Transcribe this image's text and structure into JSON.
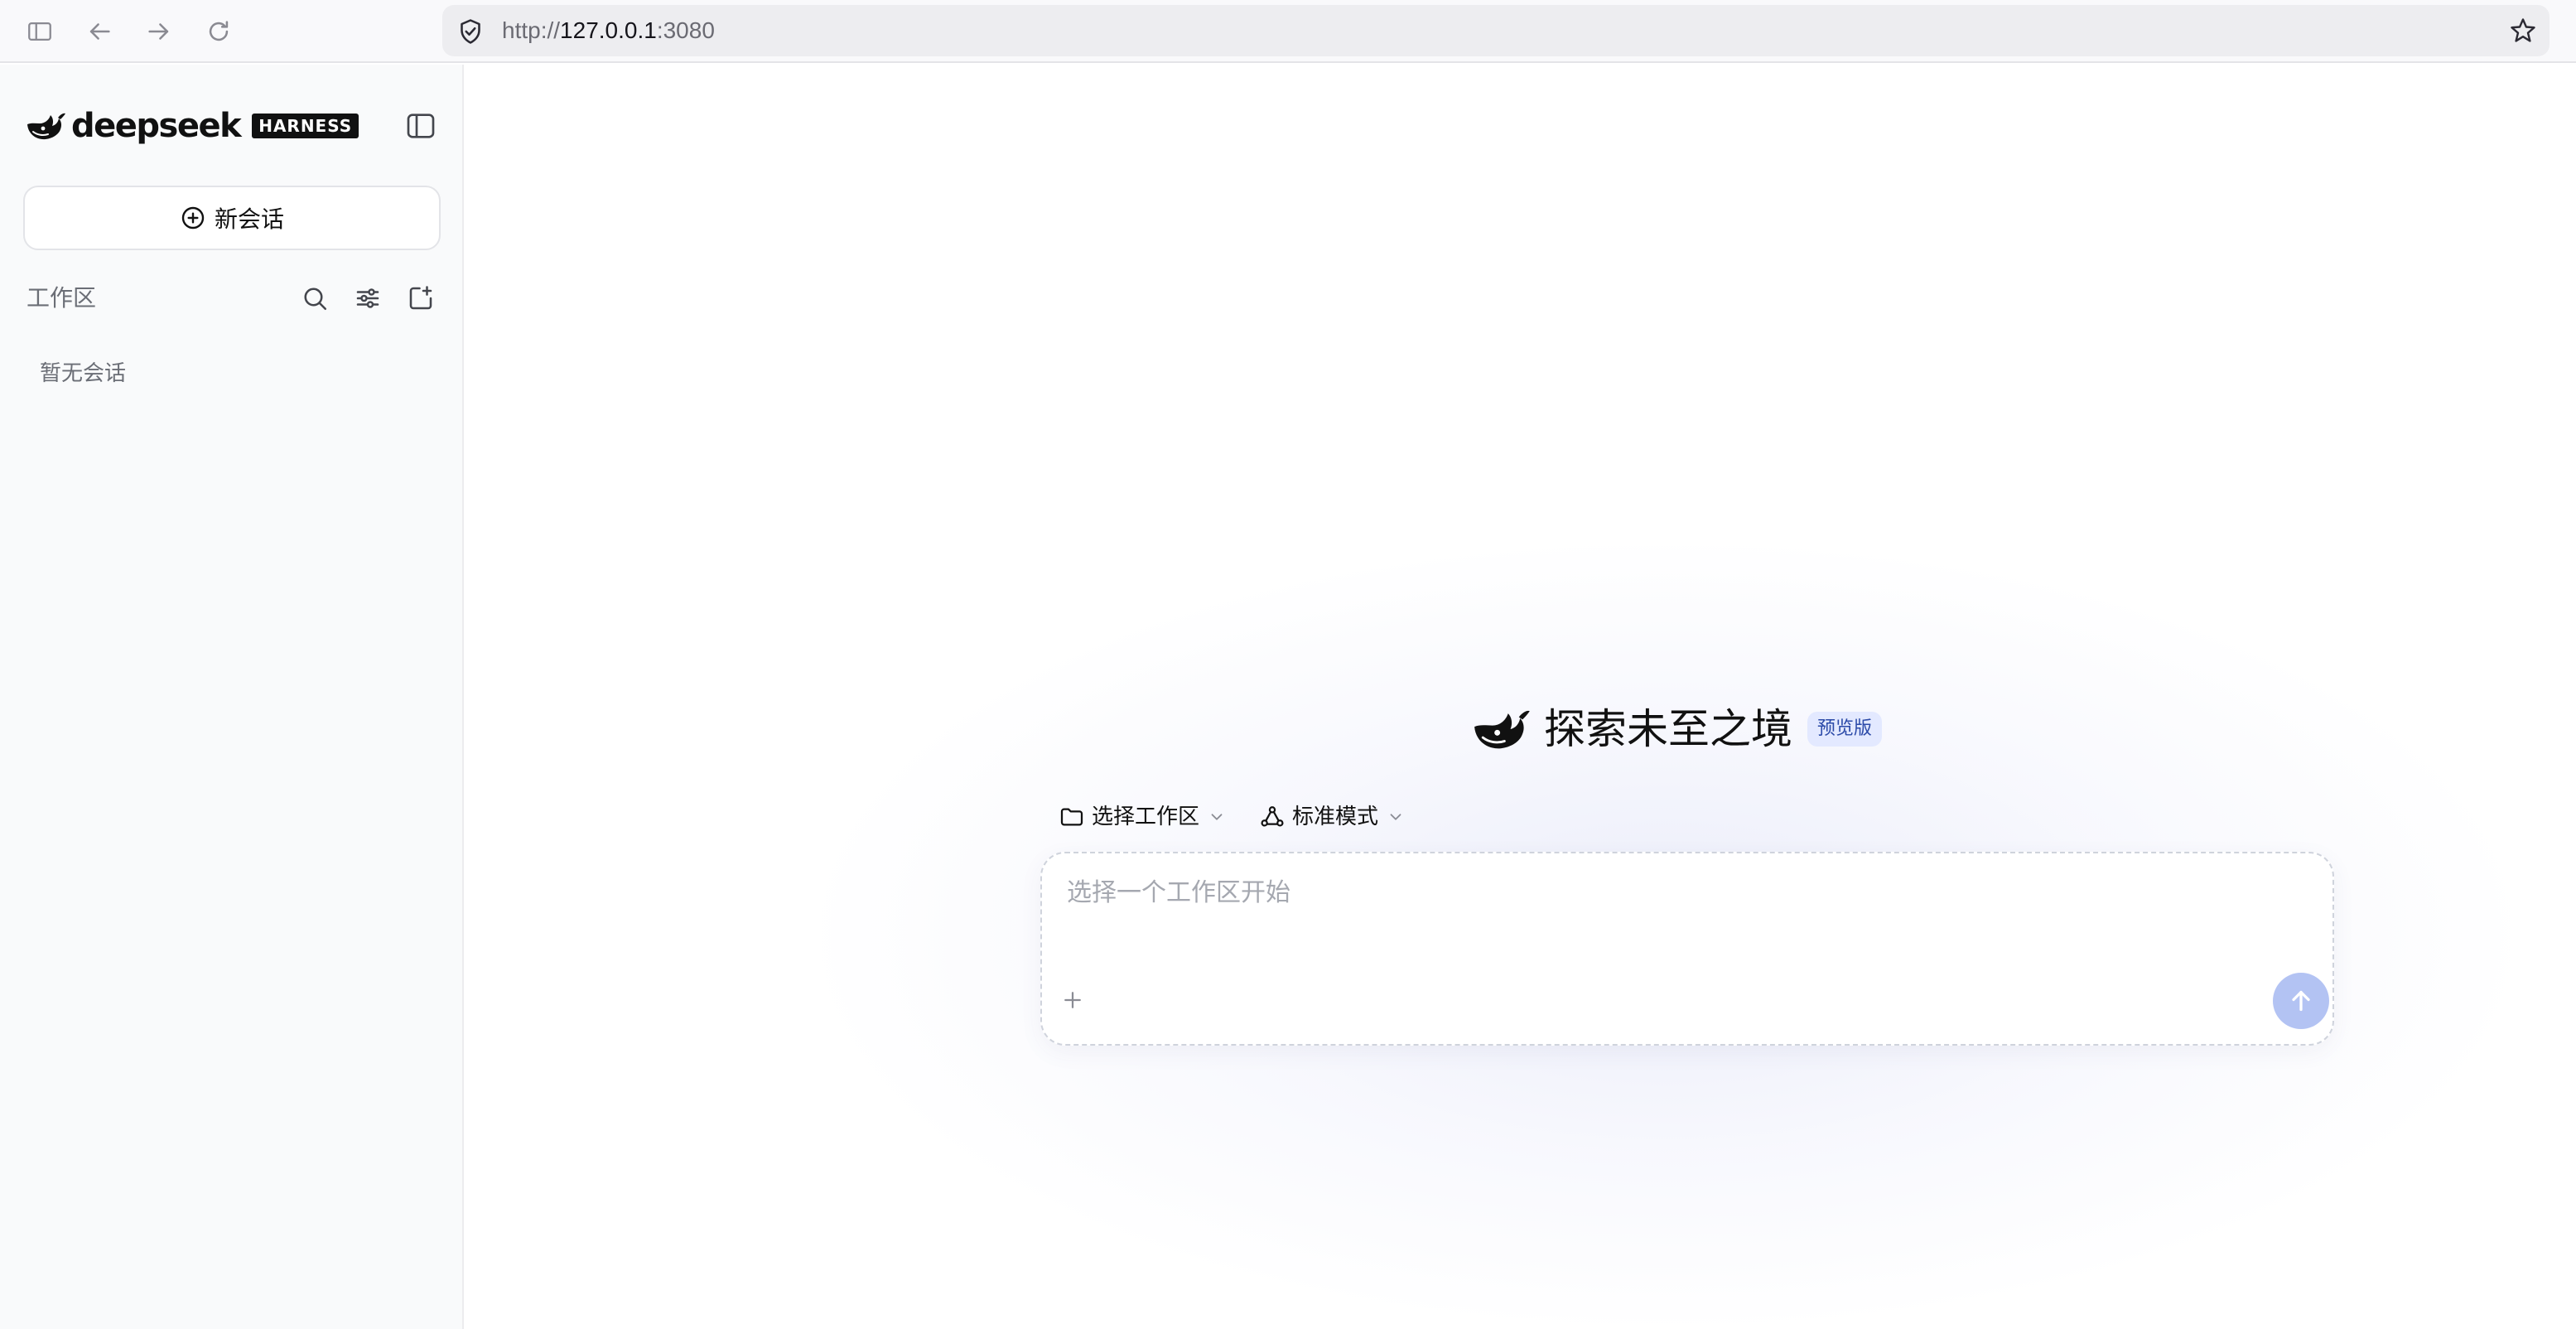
{
  "browser": {
    "url_scheme": "http://",
    "url_host": "127.0.0.1",
    "url_port": ":3080",
    "icons": [
      "sidebar-icon",
      "back-arrow-icon",
      "forward-arrow-icon",
      "reload-icon",
      "shield-icon",
      "bookmark-star-icon"
    ]
  },
  "sidebar": {
    "brand": "deepseek",
    "badge": "HARNESS",
    "new_chat_label": "新会话",
    "workspace_title": "工作区",
    "empty_text": "暂无会话",
    "icons": [
      "search-icon",
      "filter-sliders-icon",
      "new-folder-icon",
      "sidebar-toggle-icon"
    ]
  },
  "main": {
    "hero_title": "探索未至之境",
    "preview_badge": "预览版",
    "workspace_selector": "选择工作区",
    "mode_selector": "标准模式",
    "composer": {
      "placeholder": "选择一个工作区开始",
      "value": ""
    }
  },
  "colors": {
    "accent": "#4d6bfe",
    "send_button_disabled": "#b3c3f3",
    "badge_bg": "#e3e9ff",
    "badge_text": "#2b4aa8",
    "muted_text": "#6b6e76",
    "sidebar_bg": "#f9fafb"
  }
}
